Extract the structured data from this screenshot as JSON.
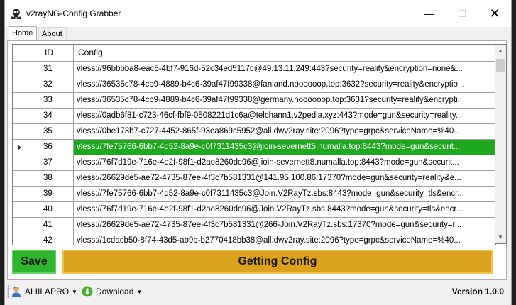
{
  "window": {
    "title": "v2rayNG-Config Grabber",
    "minimize": "—",
    "maximize": "☐",
    "close": "✕"
  },
  "tabs": [
    {
      "label": "Home",
      "active": true
    },
    {
      "label": "About",
      "active": false
    }
  ],
  "grid": {
    "columns": [
      "ID",
      "Config"
    ],
    "rows": [
      {
        "id": "31",
        "config": "vless://96bbbba8-eac5-4bf7-916d-52c34ed5117c@49.13.11.249:443?security=reality&encryption=none&..."
      },
      {
        "id": "32",
        "config": "vless://36535c78-4cb9-4889-b4c6-39af47f99338@fanland.noooooop.top:3632?security=reality&encryptio..."
      },
      {
        "id": "33",
        "config": "vless://36535c78-4cb9-4889-b4c6-39af47f99338@germany.noooooop.top:3631?security=reality&encrypti..."
      },
      {
        "id": "34",
        "config": "vless://0adb6f81-c723-46cf-fbf9-0508221d1c6a@telchann1.v2pedia.xyz:443?mode=gun&security=reality..."
      },
      {
        "id": "35",
        "config": "vless://0be173b7-c727-4452-865f-93ea869c5952@all.dwv2ray.site:2096?type=grpc&serviceName=%40..."
      },
      {
        "id": "36",
        "config": "vless://7fe75766-6bb7-4d52-8a9e-c0f7311435c3@jioin-severnett5.numalla.top:8443?mode=gun&securit...",
        "selected": true
      },
      {
        "id": "37",
        "config": "vless://76f7d19e-716e-4e2f-98f1-d2ae8260dc96@jioin-severnett8.numalla.top:8443?mode=gun&securit..."
      },
      {
        "id": "38",
        "config": "vless://26629de5-ae72-4735-87ee-4f3c7b581331@141.95.100.86:17370?mode=gun&security=reality&e..."
      },
      {
        "id": "39",
        "config": "vless://7fe75766-6bb7-4d52-8a9e-c0f7311435c3@Join.V2RayTz.sbs:8443?mode=gun&security=tls&encr..."
      },
      {
        "id": "40",
        "config": "vless://76f7d19e-716e-4e2f-98f1-d2ae8260dc96@Join.V2RayTz.sbs:8443?mode=gun&security=tls&encr..."
      },
      {
        "id": "41",
        "config": "vless://26629de5-ae72-4735-87ee-4f3c7b581331@266-Join.V2RayTz.sbs:17370?mode=gun&security=r..."
      },
      {
        "id": "42",
        "config": "vless://1cdacb50-8f74-43d5-ab9b-b2770418bb38@all.dwv2ray.site:2096?type=grpc&serviceName=%40..."
      }
    ]
  },
  "buttons": {
    "save": "Save",
    "getting_config": "Getting Config"
  },
  "statusbar": {
    "user": "ALIILAPRO",
    "download": "Download",
    "version": "Version 1.0.0"
  },
  "colors": {
    "selected_row": "#1fa81f",
    "save_button": "#2db52d",
    "getting_button": "#dca21e"
  }
}
